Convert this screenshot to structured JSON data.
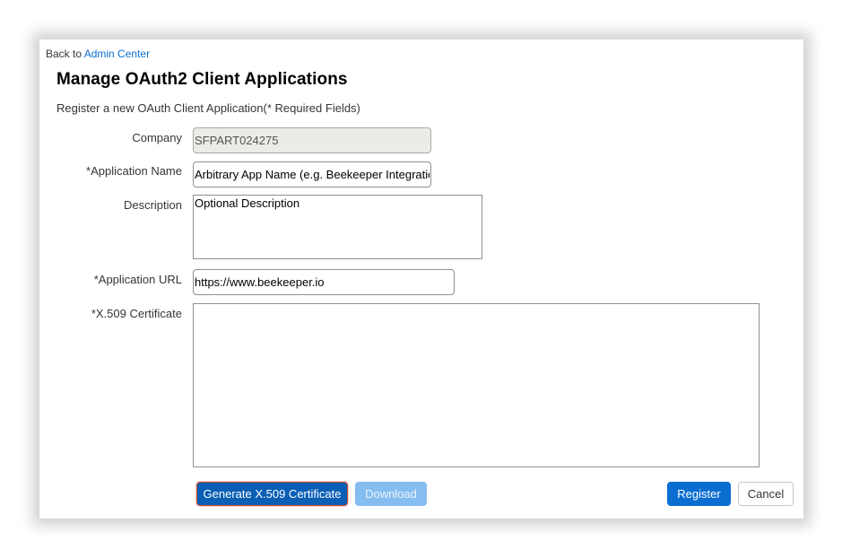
{
  "nav": {
    "back_prefix": "Back to",
    "back_link": "Admin Center"
  },
  "page": {
    "title": "Manage OAuth2 Client Applications",
    "subtitle": "Register a new OAuth Client Application(* Required Fields)"
  },
  "form": {
    "company": {
      "label": "Company",
      "value": "SFPART024275"
    },
    "application_name": {
      "label": "*Application Name",
      "value": "Arbitrary App Name (e.g. Beekeeper Integration)"
    },
    "description": {
      "label": "Description",
      "value": "Optional Description"
    },
    "application_url": {
      "label": "*Application URL",
      "value": "https://www.beekeeper.io"
    },
    "certificate": {
      "label": "*X.509 Certificate",
      "value": ""
    }
  },
  "buttons": {
    "generate": "Generate X.509 Certificate",
    "download": "Download",
    "register": "Register",
    "cancel": "Cancel"
  },
  "colors": {
    "accent": "#0a6ed1",
    "link": "#0a6ed1",
    "disabled": "#86bdf0",
    "readonly_bg": "#ebebe8"
  }
}
